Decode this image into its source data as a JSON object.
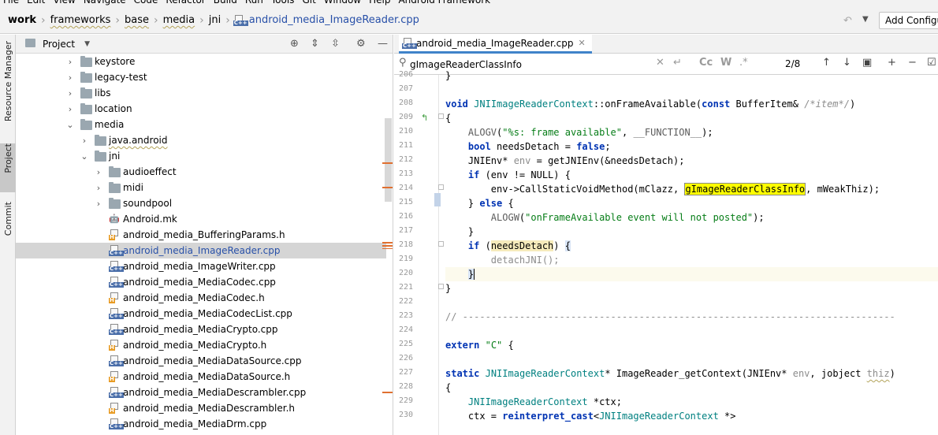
{
  "menu": [
    "File",
    "Edit",
    "View",
    "Navigate",
    "Code",
    "Refactor",
    "Build",
    "Run",
    "Tools",
    "Git",
    "Window",
    "Help",
    "Android Framework"
  ],
  "breadcrumb": {
    "items": [
      "work",
      "frameworks",
      "base",
      "media",
      "jni"
    ],
    "file": "android_media_ImageReader.cpp"
  },
  "toolbar": {
    "add_config_label": "Add Configur"
  },
  "sidebar": {
    "resource_manager": "Resource Manager",
    "project": "Project",
    "commit": "Commit"
  },
  "project_panel": {
    "title": "Project",
    "tree": [
      {
        "label": "keystore",
        "type": "folder",
        "arrow": "›"
      },
      {
        "label": "legacy-test",
        "type": "folder",
        "arrow": "›"
      },
      {
        "label": "libs",
        "type": "folder",
        "arrow": "›"
      },
      {
        "label": "location",
        "type": "folder",
        "arrow": "›"
      },
      {
        "label": "media",
        "type": "folder",
        "arrow": "⌄"
      },
      {
        "label": "java.android",
        "type": "folder",
        "arrow": "›"
      },
      {
        "label": "jni",
        "type": "folder",
        "arrow": "⌄"
      },
      {
        "label": "audioeffect",
        "type": "folder",
        "arrow": "›"
      },
      {
        "label": "midi",
        "type": "folder",
        "arrow": "›"
      },
      {
        "label": "soundpool",
        "type": "folder",
        "arrow": "›"
      },
      {
        "label": "Android.mk",
        "type": "android"
      },
      {
        "label": "android_media_BufferingParams.h",
        "type": "h"
      },
      {
        "label": "android_media_ImageReader.cpp",
        "type": "cpp",
        "selected": true
      },
      {
        "label": "android_media_ImageWriter.cpp",
        "type": "cpp"
      },
      {
        "label": "android_media_MediaCodec.cpp",
        "type": "cpp"
      },
      {
        "label": "android_media_MediaCodec.h",
        "type": "h"
      },
      {
        "label": "android_media_MediaCodecList.cpp",
        "type": "cpp"
      },
      {
        "label": "android_media_MediaCrypto.cpp",
        "type": "cpp"
      },
      {
        "label": "android_media_MediaCrypto.h",
        "type": "h"
      },
      {
        "label": "android_media_MediaDataSource.cpp",
        "type": "cpp"
      },
      {
        "label": "android_media_MediaDataSource.h",
        "type": "h"
      },
      {
        "label": "android_media_MediaDescrambler.cpp",
        "type": "cpp"
      },
      {
        "label": "android_media_MediaDescrambler.h",
        "type": "h"
      },
      {
        "label": "android_media_MediaDrm.cpp",
        "type": "cpp"
      }
    ]
  },
  "editor": {
    "tab_label": "android_media_ImageReader.cpp",
    "search_value": "gImageReaderClassInfo",
    "match_count": "2/8",
    "search_options": [
      "Cc",
      "W",
      ".*"
    ],
    "line_numbers": [
      "206",
      "207",
      "208",
      "209",
      "210",
      "211",
      "212",
      "213",
      "214",
      "215",
      "216",
      "217",
      "218",
      "219",
      "220",
      "221",
      "222",
      "223",
      "224",
      "225",
      "226",
      "227",
      "228",
      "229",
      "230"
    ]
  },
  "colors": {
    "keyword": "#0033b3",
    "string": "#067d17",
    "type": "#008080",
    "search_highlight": "#ffff00",
    "accent": "#4083c9"
  }
}
